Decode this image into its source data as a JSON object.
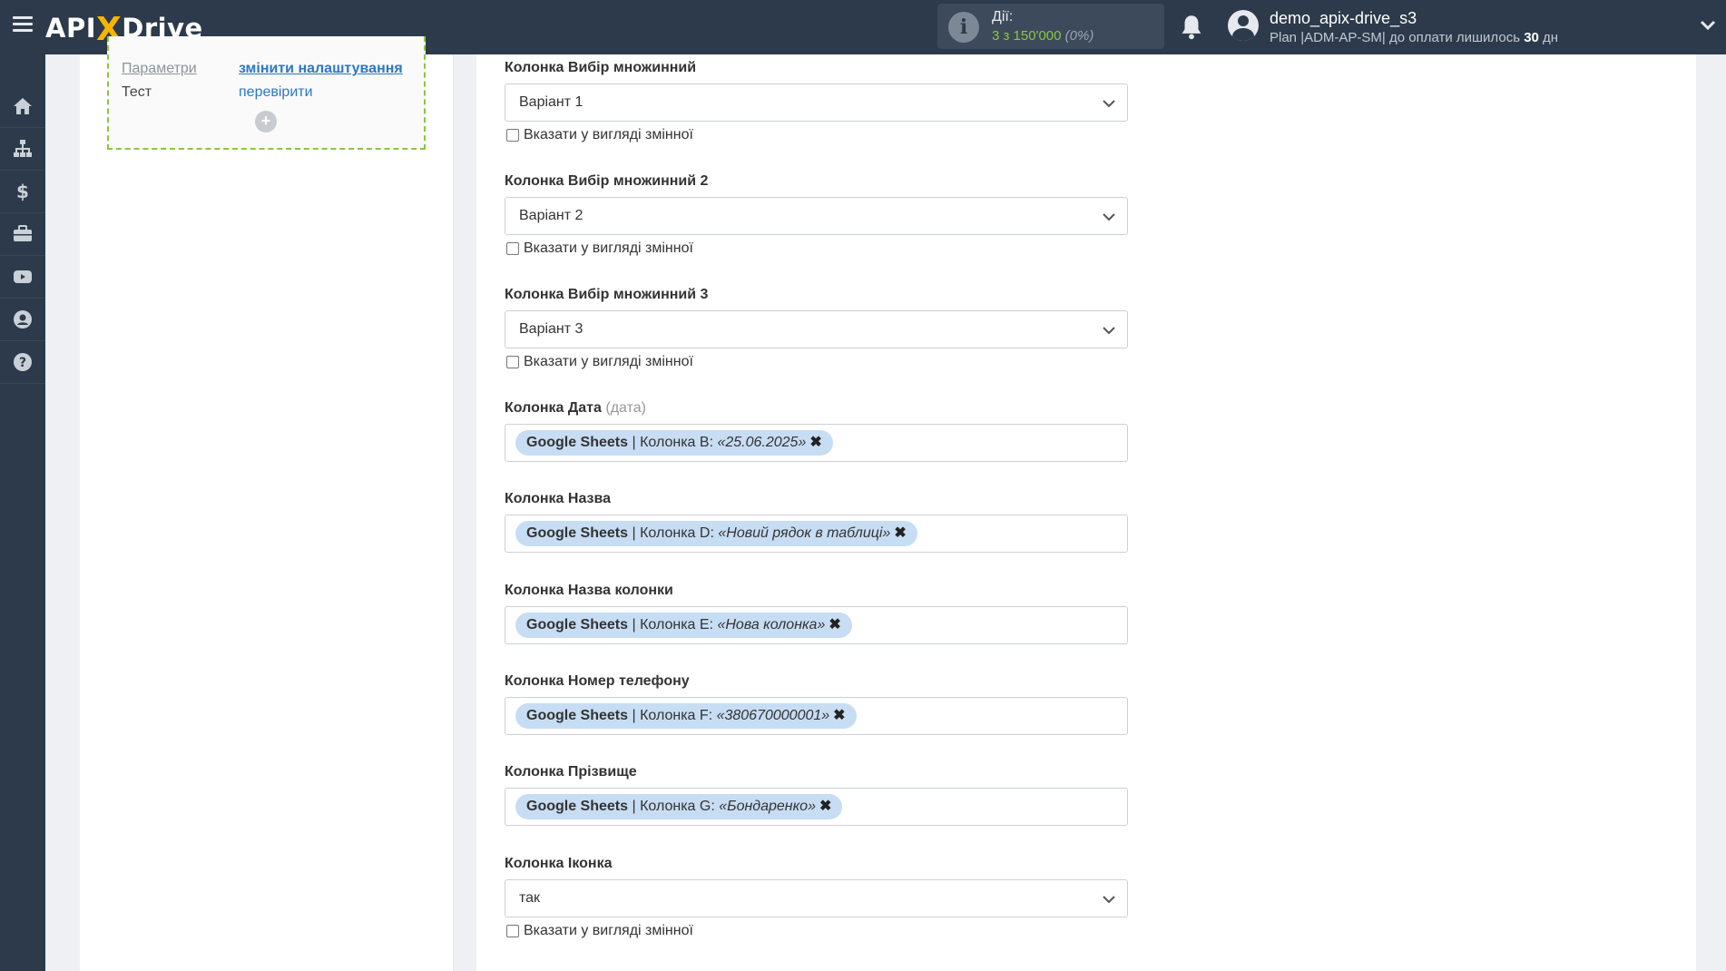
{
  "header": {
    "logo_left": "API",
    "logo_x": "X",
    "logo_right": "Drive",
    "actions_label": "Дії:",
    "actions_value": "3 з 150'000",
    "actions_percent": "(0%)",
    "username": "demo_apix-drive_s3",
    "plan_text": "Plan |ADM-AP-SM| до оплати лишилось",
    "plan_days": "30",
    "plan_unit": "дн"
  },
  "sidebar": {
    "items": [
      "home-icon",
      "sitemap-icon",
      "dollar-icon",
      "briefcase-icon",
      "video-icon",
      "user-icon",
      "help-icon"
    ]
  },
  "left_panel": {
    "rows": [
      {
        "label": "Параметри",
        "link": "змінити налаштування"
      },
      {
        "label": "Тест",
        "link": "перевірити"
      }
    ],
    "add_label": "+"
  },
  "form": {
    "checkbox_label": "Вказати у вигляді змінної",
    "fields": [
      {
        "label": "Колонка Вибір множинний",
        "type": "select",
        "value": "Варіант 1"
      },
      {
        "label": "Колонка Вибір множинний 2",
        "type": "select",
        "value": "Варіант 2"
      },
      {
        "label": "Колонка Вибір множинний 3",
        "type": "select",
        "value": "Варіант 3"
      },
      {
        "label": "Колонка Дата",
        "hint": "(дата)",
        "type": "tag",
        "source": "Google Sheets",
        "column": "| Колонка B:",
        "value": "«25.06.2025»"
      },
      {
        "label": "Колонка Назва",
        "type": "tag",
        "source": "Google Sheets",
        "column": "| Колонка D:",
        "value": "«Новий рядок в таблиці»"
      },
      {
        "label": "Колонка Назва колонки",
        "type": "tag",
        "source": "Google Sheets",
        "column": "| Колонка E:",
        "value": "«Нова колонка»"
      },
      {
        "label": "Колонка Номер телефону",
        "type": "tag",
        "source": "Google Sheets",
        "column": "| Колонка F:",
        "value": "«380670000001»"
      },
      {
        "label": "Колонка Прізвище",
        "type": "tag",
        "source": "Google Sheets",
        "column": "| Колонка G:",
        "value": "«Бондаренко»"
      },
      {
        "label": "Колонка Іконка",
        "type": "select",
        "value": "так"
      }
    ]
  },
  "colors": {
    "topbar": "#2c3a4b",
    "accent_green": "#8cc63f",
    "tag_bg": "#c7ddf3",
    "link_blue": "#2b78c5"
  }
}
